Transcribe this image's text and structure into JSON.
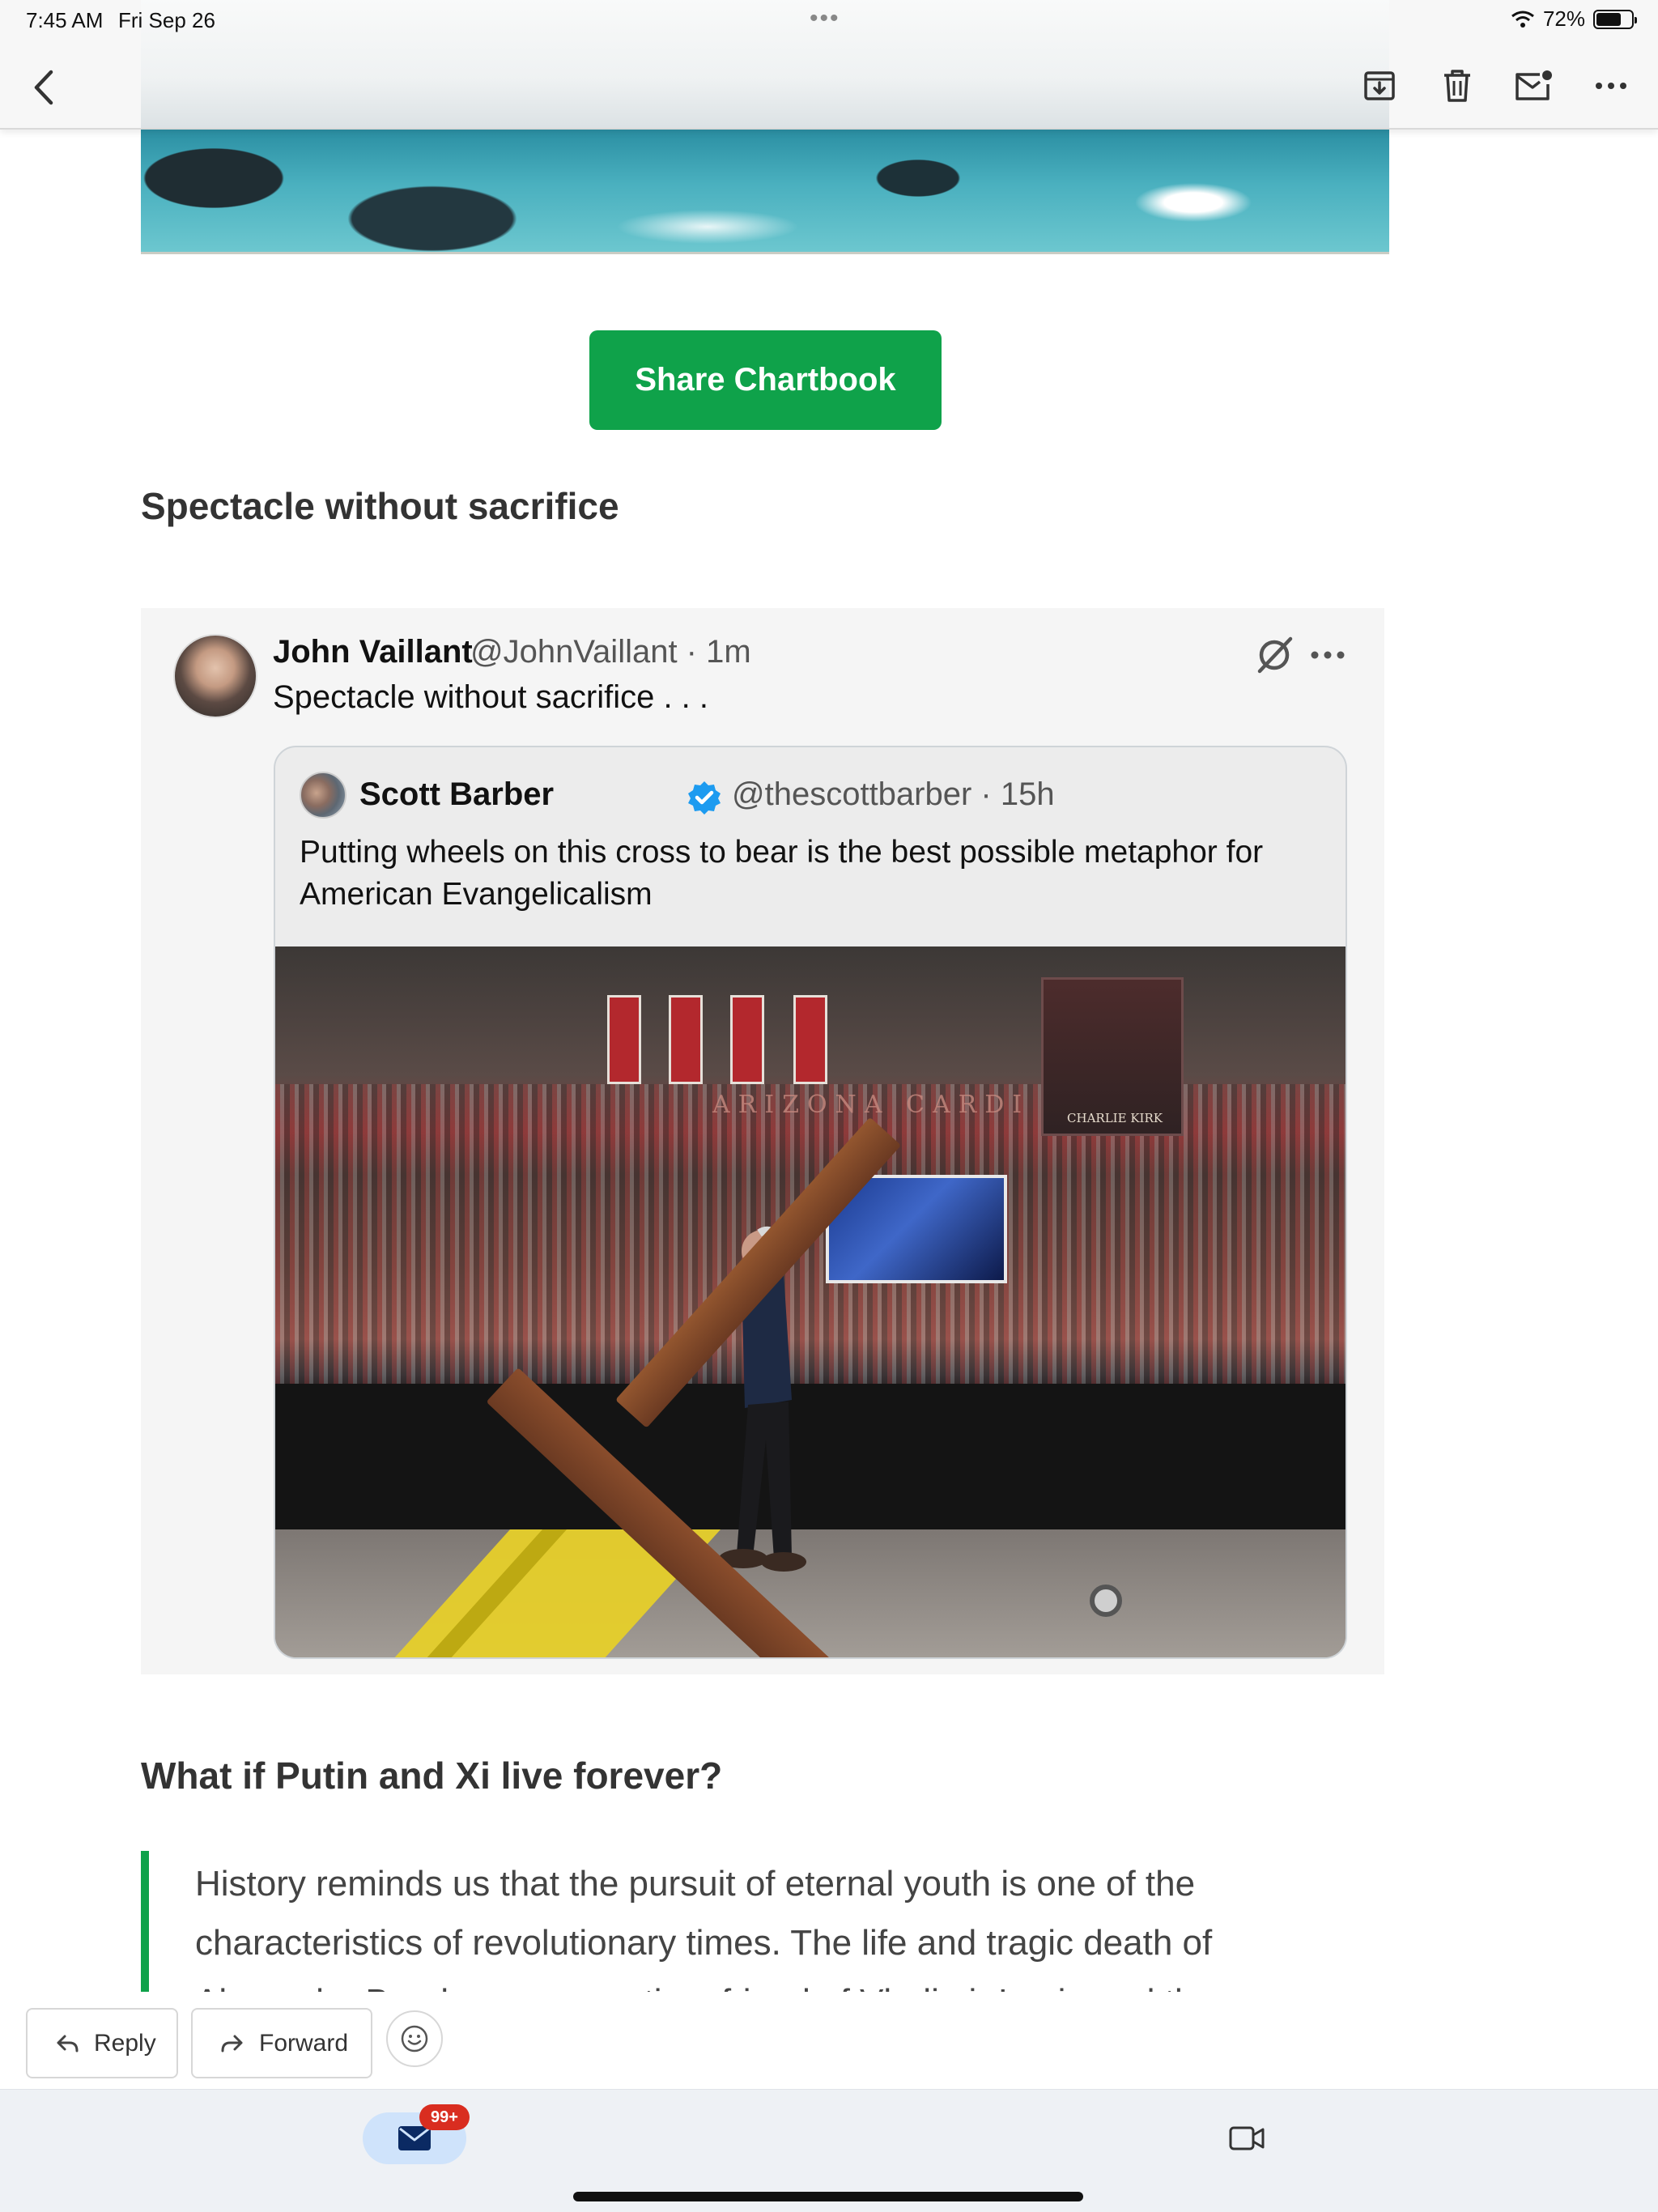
{
  "status_bar": {
    "time": "7:45 AM",
    "date": "Fri Sep 26",
    "battery": "72%",
    "battery_level": 0.72
  },
  "toolbar": {
    "icons": [
      "back-icon",
      "archive-icon",
      "trash-icon",
      "mark-unread-icon",
      "more-icon"
    ]
  },
  "article": {
    "share_button": "Share Chartbook",
    "section1_heading": "Spectacle without sacrifice",
    "section2_heading": "What if Putin and Xi live forever?",
    "section2_body": "History reminds us that the pursuit of eternal youth is one of the characteristics of revolutionary times. The life and tragic death of Alexander Bogdanov, a one-time friend of Vladimir Lenin and the"
  },
  "tweet": {
    "author_name": "John Vaillant",
    "author_meta": "@JohnVaillant · 1m",
    "text": "Spectacle without sacrifice . . .",
    "quoted": {
      "author_name": "Scott Barber",
      "author_meta": "@thescottbarber · 15h",
      "verified": true,
      "text": "Putting wheels on this cross to bear is the best possible metaphor for American Evangelicalism",
      "photo_sign_text": "CHARLIE KIRK",
      "photo_arena_text": "ARIZONA CARDI"
    }
  },
  "actions": {
    "reply": "Reply",
    "forward": "Forward"
  },
  "tabbar": {
    "mail_badge": "99+"
  },
  "colors": {
    "accent_green": "#0fa24a",
    "badge_red": "#d92d20",
    "mail_tab_bg": "#cfe3fb",
    "verified_blue": "#1d9bf0"
  }
}
